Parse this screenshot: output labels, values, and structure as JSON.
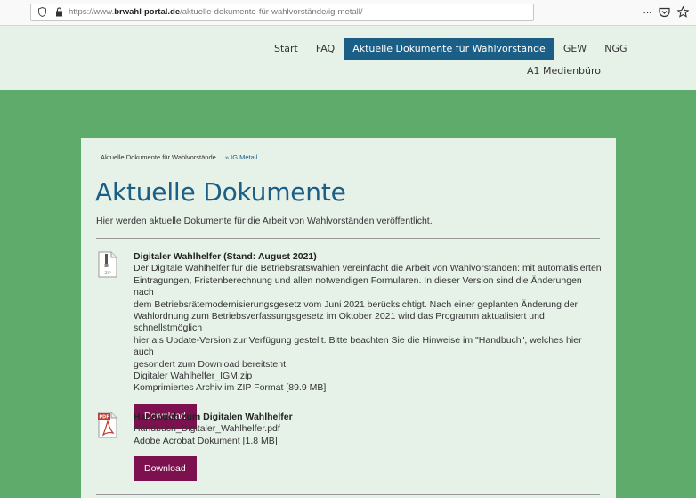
{
  "browser": {
    "url_prefix": "https://www.",
    "url_domain": "brwahl-portal.de",
    "url_path": "/aktuelle-dokumente-für-wahlvorstände/ig-metall/",
    "menu_dots": "···"
  },
  "nav": {
    "items": [
      {
        "label": "Start"
      },
      {
        "label": "FAQ"
      },
      {
        "label": "Aktuelle Dokumente für Wahlvorstände"
      },
      {
        "label": "GEW"
      },
      {
        "label": "NGG"
      }
    ],
    "row2_label": "A1 Medienbüro"
  },
  "breadcrumb": {
    "parent": "Aktuelle Dokumente für Wahlvorstände",
    "separator": "»",
    "current": "IG Metall"
  },
  "page": {
    "title": "Aktuelle Dokumente",
    "intro": "Hier werden aktuelle Dokumente für die Arbeit von Wahlvorständen veröffentlicht."
  },
  "documents": [
    {
      "title": "Digitaler Wahlhelfer (Stand: August 2021)",
      "description_lines": [
        "Der Digitale Wahlhelfer für die Betriebsratswahlen vereinfacht die Arbeit von Wahlvorständen: mit automatisierten",
        "Eintragungen, Fristenberechnung und allen notwendigen Formularen. In dieser Version sind die Änderungen nach",
        "dem Betriebsrätemodernisierungsgesetz vom Juni 2021 berücksichtigt. Nach einer geplanten Änderung der",
        "Wahlordnung zum Betriebsverfassungsgesetz im Oktober 2021 wird das Programm aktualisiert und schnellstmöglich",
        "hier als Update-Version zur Verfügung gestellt. Bitte beachten Sie die Hinweise im \"Handbuch\", welches hier auch",
        "gesondert zum Download bereitsteht."
      ],
      "filename": "Digitaler Wahlhelfer_IGM.zip",
      "filetype": "Komprimiertes Archiv im ZIP Format [89.9 MB]",
      "button": "Download",
      "icon_label": "ZIP"
    },
    {
      "title": "Handbuch zum Digitalen Wahlhelfer",
      "filename": "Handbuch_Digitaler_Wahlhelfer.pdf",
      "filetype": "Adobe Acrobat Dokument [1.8 MB]",
      "button": "Download",
      "icon_label": "PDF"
    }
  ],
  "colors": {
    "page_bg": "#5fab6c",
    "panel_bg": "#e6f1e8",
    "accent_blue": "#1b5e86",
    "button_bg": "#7d1150"
  }
}
